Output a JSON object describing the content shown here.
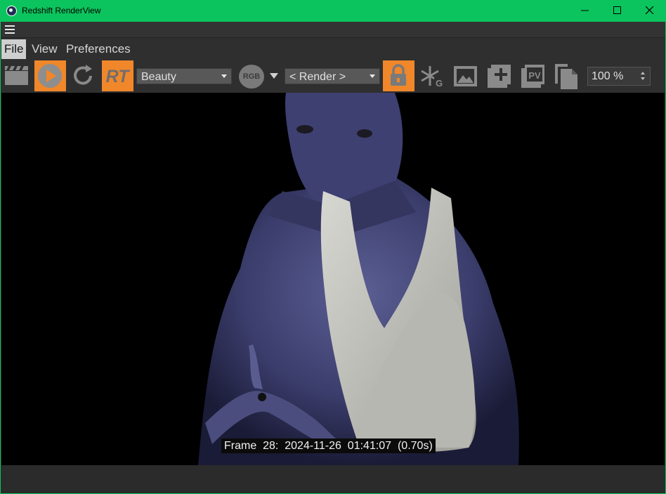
{
  "window": {
    "title": "Redshift RenderView"
  },
  "menu": {
    "items": [
      "File",
      "View",
      "Preferences"
    ]
  },
  "toolbar": {
    "aov_select": "Beauty",
    "channel_label": "RGB",
    "camera_select": "< Render >",
    "rt_label": "RT",
    "pv_label": "PV",
    "zoom_value": "100 %"
  },
  "render": {
    "frame_label": "Frame  28:  2024-11-26  01:41:07  (0.70s)"
  },
  "colors": {
    "titlebar": "#0bc45d",
    "accent_orange": "#f0872a",
    "panel": "#2f2f2f"
  },
  "icons": [
    "clapperboard-icon",
    "play-icon",
    "refresh-icon",
    "lock-icon",
    "snowflake-g-icon",
    "image-icon",
    "add-snapshot-icon",
    "pv-icon",
    "copy-icon"
  ]
}
